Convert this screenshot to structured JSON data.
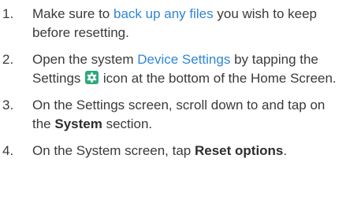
{
  "steps": [
    {
      "number": "1.",
      "before": "Make sure to ",
      "link": "back up any files",
      "after": " you wish to keep before resetting."
    },
    {
      "number": "2.",
      "before": "Open the system ",
      "link": "Device Settings",
      "middle": " by tapping the Settings ",
      "icon": "settings-gear-icon",
      "after": " icon at the bottom of the Home Screen."
    },
    {
      "number": "3.",
      "before": "On the Settings screen, scroll down to and tap on the ",
      "bold": "System",
      "after": " section."
    },
    {
      "number": "4.",
      "before": "On the System screen, tap ",
      "bold": "Reset options",
      "after": "."
    }
  ],
  "colors": {
    "link": "#2f86d4",
    "text": "#3a3a3a",
    "icon_bg": "#2eaa7a"
  }
}
